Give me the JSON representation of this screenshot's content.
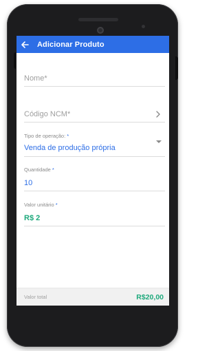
{
  "appbar": {
    "title": "Adicionar Produto"
  },
  "form": {
    "nome": {
      "placeholder": "Nome*"
    },
    "ncm": {
      "placeholder": "Código NCM*"
    },
    "tipo_operacao": {
      "label": "Tipo de operação:",
      "required_mark": "*",
      "value": "Venda de produção própria"
    },
    "quantidade": {
      "label": "Quantidade",
      "required_mark": "*",
      "value": "10"
    },
    "valor_unitario": {
      "label": "Valor unitário",
      "required_mark": "*",
      "value": "R$ 2"
    }
  },
  "footer": {
    "label": "Valor total",
    "value": "R$20,00"
  },
  "colors": {
    "primary": "#2d6ee6",
    "money": "#1ea97c"
  },
  "icons": {
    "back": "arrow-left-icon",
    "ncm_action": "chevron-right-icon",
    "dropdown": "caret-down-icon"
  }
}
